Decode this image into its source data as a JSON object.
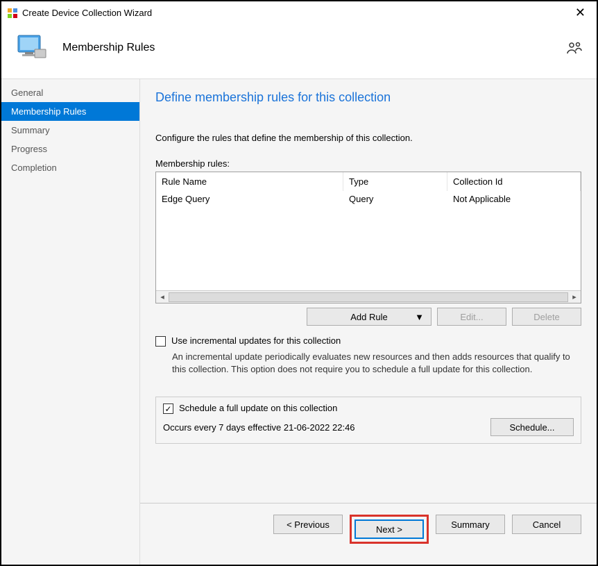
{
  "window": {
    "title": "Create Device Collection Wizard"
  },
  "banner": {
    "title": "Membership Rules"
  },
  "sidebar": {
    "items": [
      {
        "label": "General"
      },
      {
        "label": "Membership Rules"
      },
      {
        "label": "Summary"
      },
      {
        "label": "Progress"
      },
      {
        "label": "Completion"
      }
    ]
  },
  "page": {
    "heading": "Define membership rules for this collection",
    "instruction": "Configure the rules that define the membership of this collection.",
    "rules_label": "Membership rules:",
    "columns": {
      "name": "Rule Name",
      "type": "Type",
      "id": "Collection Id"
    },
    "rows": [
      {
        "name": "Edge Query",
        "type": "Query",
        "id": "Not Applicable"
      }
    ],
    "buttons": {
      "add_rule": "Add Rule",
      "edit": "Edit...",
      "delete": "Delete"
    },
    "incremental": {
      "label": "Use incremental updates for this collection",
      "desc": "An incremental update periodically evaluates new resources and then adds resources that qualify to this collection. This option does not require you to schedule a full update for this collection."
    },
    "schedule": {
      "checkbox": "Schedule a full update on this collection",
      "text": "Occurs every 7 days effective 21-06-2022 22:46",
      "button": "Schedule..."
    }
  },
  "footer": {
    "previous": "< Previous",
    "next": "Next >",
    "summary": "Summary",
    "cancel": "Cancel"
  }
}
